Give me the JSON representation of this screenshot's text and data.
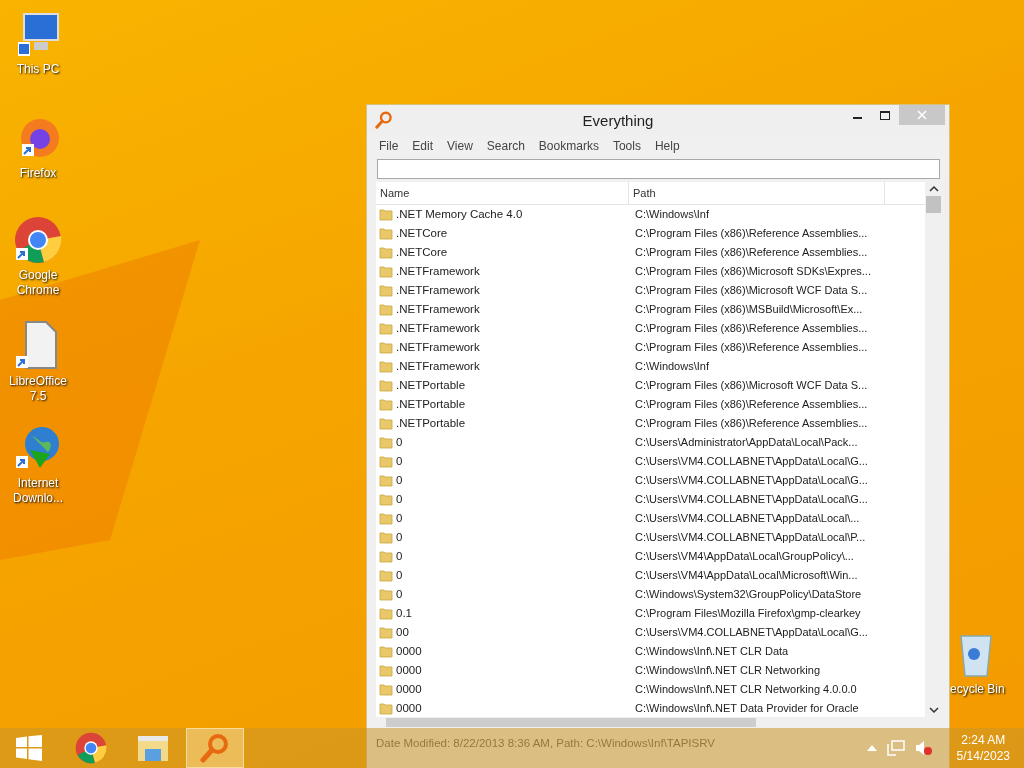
{
  "desktop_icons": [
    {
      "label": "This PC",
      "kind": "pc"
    },
    {
      "label": "Firefox",
      "kind": "firefox"
    },
    {
      "label": "Google Chrome",
      "kind": "chrome"
    },
    {
      "label": "LibreOffice 7.5",
      "kind": "document"
    },
    {
      "label": "Internet Downlo...",
      "kind": "globe"
    },
    {
      "label": "ecycle Bin",
      "kind": "bin"
    }
  ],
  "window": {
    "title": "Everything",
    "menu": [
      "File",
      "Edit",
      "View",
      "Search",
      "Bookmarks",
      "Tools",
      "Help"
    ],
    "table": {
      "columns": [
        "Name",
        "Path"
      ],
      "rows": [
        {
          "name": ".NET Memory Cache 4.0",
          "path": "C:\\Windows\\Inf"
        },
        {
          "name": ".NETCore",
          "path": "C:\\Program Files (x86)\\Reference Assemblies..."
        },
        {
          "name": ".NETCore",
          "path": "C:\\Program Files (x86)\\Reference Assemblies..."
        },
        {
          "name": ".NETFramework",
          "path": "C:\\Program Files (x86)\\Microsoft SDKs\\Expres..."
        },
        {
          "name": ".NETFramework",
          "path": "C:\\Program Files (x86)\\Microsoft WCF Data S..."
        },
        {
          "name": ".NETFramework",
          "path": "C:\\Program Files (x86)\\MSBuild\\Microsoft\\Ex..."
        },
        {
          "name": ".NETFramework",
          "path": "C:\\Program Files (x86)\\Reference Assemblies..."
        },
        {
          "name": ".NETFramework",
          "path": "C:\\Program Files (x86)\\Reference Assemblies..."
        },
        {
          "name": ".NETFramework",
          "path": "C:\\Windows\\Inf"
        },
        {
          "name": ".NETPortable",
          "path": "C:\\Program Files (x86)\\Microsoft WCF Data S..."
        },
        {
          "name": ".NETPortable",
          "path": "C:\\Program Files (x86)\\Reference Assemblies..."
        },
        {
          "name": ".NETPortable",
          "path": "C:\\Program Files (x86)\\Reference Assemblies..."
        },
        {
          "name": "0",
          "path": "C:\\Users\\Administrator\\AppData\\Local\\Pack..."
        },
        {
          "name": "0",
          "path": "C:\\Users\\VM4.COLLABNET\\AppData\\Local\\G..."
        },
        {
          "name": "0",
          "path": "C:\\Users\\VM4.COLLABNET\\AppData\\Local\\G..."
        },
        {
          "name": "0",
          "path": "C:\\Users\\VM4.COLLABNET\\AppData\\Local\\G..."
        },
        {
          "name": "0",
          "path": "C:\\Users\\VM4.COLLABNET\\AppData\\Local\\..."
        },
        {
          "name": "0",
          "path": "C:\\Users\\VM4.COLLABNET\\AppData\\Local\\P..."
        },
        {
          "name": "0",
          "path": "C:\\Users\\VM4\\AppData\\Local\\GroupPolicy\\..."
        },
        {
          "name": "0",
          "path": "C:\\Users\\VM4\\AppData\\Local\\Microsoft\\Win..."
        },
        {
          "name": "0",
          "path": "C:\\Windows\\System32\\GroupPolicy\\DataStore"
        },
        {
          "name": "0.1",
          "path": "C:\\Program Files\\Mozilla Firefox\\gmp-clearkey"
        },
        {
          "name": "00",
          "path": "C:\\Users\\VM4.COLLABNET\\AppData\\Local\\G..."
        },
        {
          "name": "0000",
          "path": "C:\\Windows\\Inf\\.NET CLR Data"
        },
        {
          "name": "0000",
          "path": "C:\\Windows\\Inf\\.NET CLR Networking"
        },
        {
          "name": "0000",
          "path": "C:\\Windows\\Inf\\.NET CLR Networking 4.0.0.0"
        },
        {
          "name": "0000",
          "path": "C:\\Windows\\Inf\\.NET Data Provider for Oracle"
        }
      ]
    },
    "status_bar": "Date Modified: 8/22/2013 8:36 AM, Path: C:\\Windows\\Inf\\TAPISRV"
  },
  "taskbar": {
    "items": [
      {
        "kind": "start",
        "selected": false
      },
      {
        "kind": "chrome",
        "selected": false
      },
      {
        "kind": "explorer",
        "selected": false
      },
      {
        "kind": "search",
        "selected": true
      }
    ],
    "clock": {
      "time": "2:24 AM",
      "date": "5/14/2023"
    }
  }
}
